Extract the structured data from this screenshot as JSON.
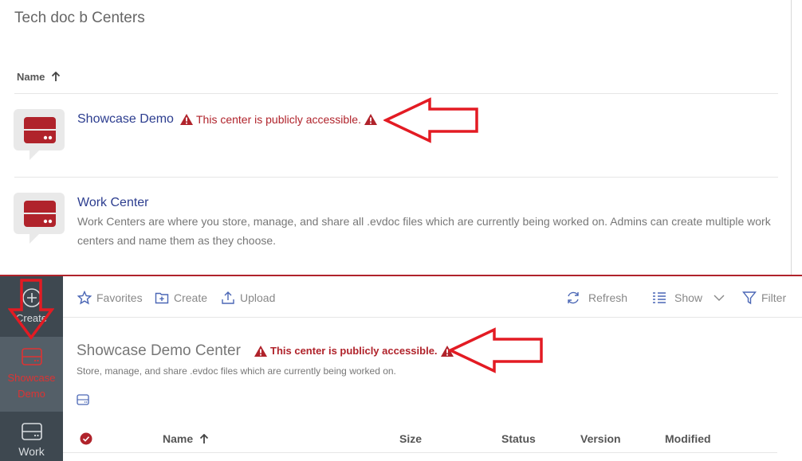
{
  "top": {
    "title": "Tech doc b Centers",
    "column_name": "Name",
    "centers": [
      {
        "name": "Showcase Demo",
        "warning": "This center is publicly accessible."
      },
      {
        "name": "Work Center",
        "description": "Work Centers are where you store, manage, and share all .evdoc files which are currently being worked on. Admins can create multiple work centers and name them as they choose."
      }
    ]
  },
  "sidebar": {
    "items": [
      {
        "label": "Create",
        "icon": "plus-circle-icon"
      },
      {
        "label": "Showcase Demo",
        "icon": "drive-icon",
        "active": true
      },
      {
        "label": "Work",
        "icon": "drive-icon"
      }
    ]
  },
  "toolbar": {
    "favorites": "Favorites",
    "create": "Create",
    "upload": "Upload",
    "refresh": "Refresh",
    "show": "Show",
    "filter": "Filter"
  },
  "content": {
    "title": "Showcase Demo Center",
    "warning": "This center is publicly accessible.",
    "subtitle": "Store, manage, and share .evdoc files which are currently being worked on."
  },
  "table": {
    "columns": [
      "Name",
      "Size",
      "Status",
      "Version",
      "Modified"
    ]
  },
  "colors": {
    "accent_red": "#b0232b",
    "link_blue": "#2c3d8f",
    "sidebar_bg": "#3e4850",
    "annotation_arrow": "#e31b23"
  }
}
